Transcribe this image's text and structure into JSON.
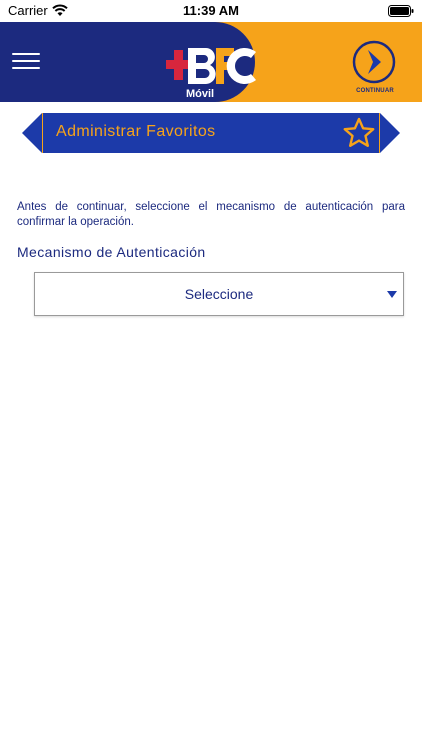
{
  "status_bar": {
    "carrier": "Carrier",
    "time": "11:39 AM"
  },
  "header": {
    "logo_text": "Móvil",
    "continue_label": "CONTINUAR",
    "icons": {
      "menu": "hamburger-icon",
      "continue": "chevron-right-circle-icon"
    }
  },
  "banner": {
    "title": "Administrar Favoritos",
    "icon": "star-icon"
  },
  "form": {
    "instructions": "Antes de continuar, seleccione el mecanismo de autenticación para confirmar la operación.",
    "field_label": "Mecanismo de Autenticación",
    "select_value": "Seleccione"
  },
  "colors": {
    "navy": "#1c2a7f",
    "blue": "#1c3aa9",
    "orange": "#f6a31a",
    "red": "#d7263d"
  }
}
